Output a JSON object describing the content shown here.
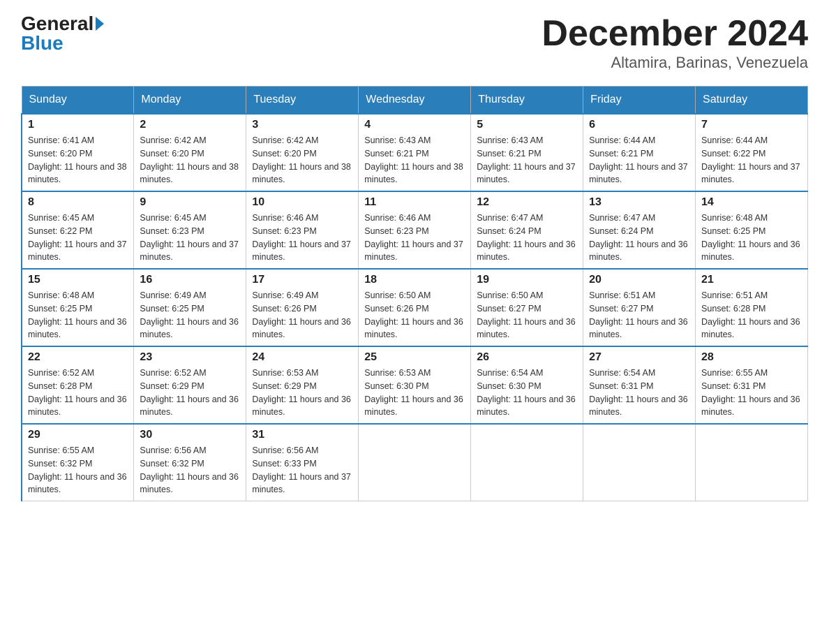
{
  "logo": {
    "general": "General",
    "blue": "Blue"
  },
  "title": "December 2024",
  "subtitle": "Altamira, Barinas, Venezuela",
  "days_of_week": [
    "Sunday",
    "Monday",
    "Tuesday",
    "Wednesday",
    "Thursday",
    "Friday",
    "Saturday"
  ],
  "weeks": [
    [
      {
        "date": "1",
        "sunrise": "6:41 AM",
        "sunset": "6:20 PM",
        "daylight": "11 hours and 38 minutes."
      },
      {
        "date": "2",
        "sunrise": "6:42 AM",
        "sunset": "6:20 PM",
        "daylight": "11 hours and 38 minutes."
      },
      {
        "date": "3",
        "sunrise": "6:42 AM",
        "sunset": "6:20 PM",
        "daylight": "11 hours and 38 minutes."
      },
      {
        "date": "4",
        "sunrise": "6:43 AM",
        "sunset": "6:21 PM",
        "daylight": "11 hours and 38 minutes."
      },
      {
        "date": "5",
        "sunrise": "6:43 AM",
        "sunset": "6:21 PM",
        "daylight": "11 hours and 37 minutes."
      },
      {
        "date": "6",
        "sunrise": "6:44 AM",
        "sunset": "6:21 PM",
        "daylight": "11 hours and 37 minutes."
      },
      {
        "date": "7",
        "sunrise": "6:44 AM",
        "sunset": "6:22 PM",
        "daylight": "11 hours and 37 minutes."
      }
    ],
    [
      {
        "date": "8",
        "sunrise": "6:45 AM",
        "sunset": "6:22 PM",
        "daylight": "11 hours and 37 minutes."
      },
      {
        "date": "9",
        "sunrise": "6:45 AM",
        "sunset": "6:23 PM",
        "daylight": "11 hours and 37 minutes."
      },
      {
        "date": "10",
        "sunrise": "6:46 AM",
        "sunset": "6:23 PM",
        "daylight": "11 hours and 37 minutes."
      },
      {
        "date": "11",
        "sunrise": "6:46 AM",
        "sunset": "6:23 PM",
        "daylight": "11 hours and 37 minutes."
      },
      {
        "date": "12",
        "sunrise": "6:47 AM",
        "sunset": "6:24 PM",
        "daylight": "11 hours and 36 minutes."
      },
      {
        "date": "13",
        "sunrise": "6:47 AM",
        "sunset": "6:24 PM",
        "daylight": "11 hours and 36 minutes."
      },
      {
        "date": "14",
        "sunrise": "6:48 AM",
        "sunset": "6:25 PM",
        "daylight": "11 hours and 36 minutes."
      }
    ],
    [
      {
        "date": "15",
        "sunrise": "6:48 AM",
        "sunset": "6:25 PM",
        "daylight": "11 hours and 36 minutes."
      },
      {
        "date": "16",
        "sunrise": "6:49 AM",
        "sunset": "6:25 PM",
        "daylight": "11 hours and 36 minutes."
      },
      {
        "date": "17",
        "sunrise": "6:49 AM",
        "sunset": "6:26 PM",
        "daylight": "11 hours and 36 minutes."
      },
      {
        "date": "18",
        "sunrise": "6:50 AM",
        "sunset": "6:26 PM",
        "daylight": "11 hours and 36 minutes."
      },
      {
        "date": "19",
        "sunrise": "6:50 AM",
        "sunset": "6:27 PM",
        "daylight": "11 hours and 36 minutes."
      },
      {
        "date": "20",
        "sunrise": "6:51 AM",
        "sunset": "6:27 PM",
        "daylight": "11 hours and 36 minutes."
      },
      {
        "date": "21",
        "sunrise": "6:51 AM",
        "sunset": "6:28 PM",
        "daylight": "11 hours and 36 minutes."
      }
    ],
    [
      {
        "date": "22",
        "sunrise": "6:52 AM",
        "sunset": "6:28 PM",
        "daylight": "11 hours and 36 minutes."
      },
      {
        "date": "23",
        "sunrise": "6:52 AM",
        "sunset": "6:29 PM",
        "daylight": "11 hours and 36 minutes."
      },
      {
        "date": "24",
        "sunrise": "6:53 AM",
        "sunset": "6:29 PM",
        "daylight": "11 hours and 36 minutes."
      },
      {
        "date": "25",
        "sunrise": "6:53 AM",
        "sunset": "6:30 PM",
        "daylight": "11 hours and 36 minutes."
      },
      {
        "date": "26",
        "sunrise": "6:54 AM",
        "sunset": "6:30 PM",
        "daylight": "11 hours and 36 minutes."
      },
      {
        "date": "27",
        "sunrise": "6:54 AM",
        "sunset": "6:31 PM",
        "daylight": "11 hours and 36 minutes."
      },
      {
        "date": "28",
        "sunrise": "6:55 AM",
        "sunset": "6:31 PM",
        "daylight": "11 hours and 36 minutes."
      }
    ],
    [
      {
        "date": "29",
        "sunrise": "6:55 AM",
        "sunset": "6:32 PM",
        "daylight": "11 hours and 36 minutes."
      },
      {
        "date": "30",
        "sunrise": "6:56 AM",
        "sunset": "6:32 PM",
        "daylight": "11 hours and 36 minutes."
      },
      {
        "date": "31",
        "sunrise": "6:56 AM",
        "sunset": "6:33 PM",
        "daylight": "11 hours and 37 minutes."
      },
      null,
      null,
      null,
      null
    ]
  ]
}
